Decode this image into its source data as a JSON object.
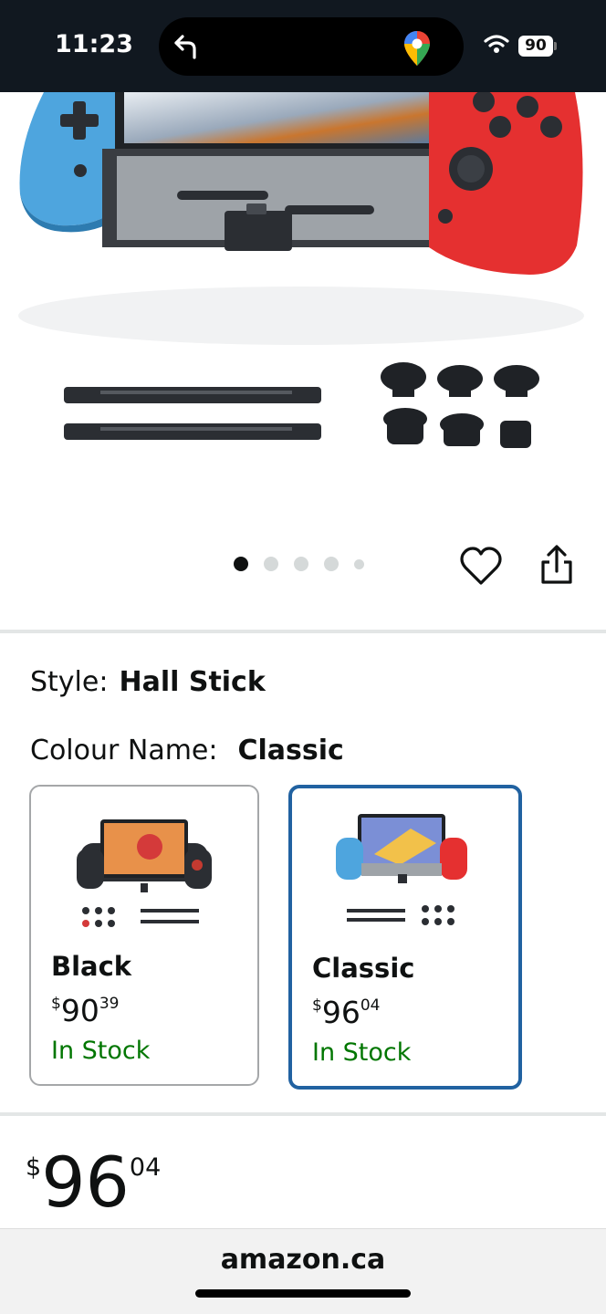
{
  "status_bar": {
    "time": "11:23",
    "battery": "90",
    "icons": [
      "back-arrow-icon",
      "google-maps-icon",
      "wifi-icon",
      "battery-icon"
    ]
  },
  "carousel": {
    "image_count": 5,
    "active_index": 0,
    "icons": [
      "heart-icon",
      "share-icon"
    ]
  },
  "style": {
    "label": "Style:",
    "value": "Hall Stick"
  },
  "colour": {
    "label": "Colour Name:",
    "value": "Classic"
  },
  "swatches": [
    {
      "name": "Black",
      "currency": "$",
      "whole": "90",
      "fraction": "39",
      "stock": "In Stock",
      "selected": false
    },
    {
      "name": "Classic",
      "currency": "$",
      "whole": "96",
      "fraction": "04",
      "stock": "In Stock",
      "selected": true
    }
  ],
  "price": {
    "currency": "$",
    "whole": "96",
    "fraction": "04"
  },
  "browser": {
    "url": "amazon.ca"
  },
  "colors": {
    "selected_border": "#2162a1",
    "in_stock": "#007600",
    "status_bar": "#111820"
  }
}
